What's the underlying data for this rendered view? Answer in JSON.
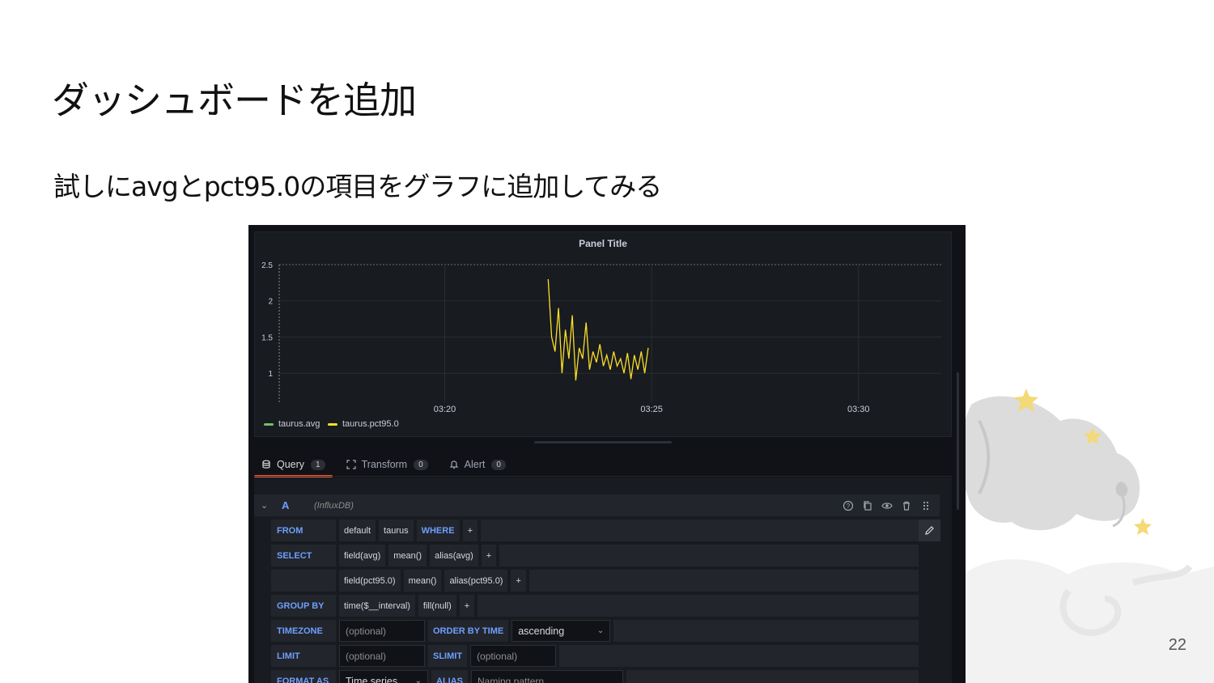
{
  "slide": {
    "title": "ダッシュボードを追加",
    "subtitle": "試しにavgとpct95.0の項目をグラフに追加してみる",
    "page_number": "22"
  },
  "panel": {
    "title": "Panel Title",
    "legend": [
      {
        "name": "taurus.avg",
        "color": "#73bf69"
      },
      {
        "name": "taurus.pct95.0",
        "color": "#fade2a"
      }
    ]
  },
  "chart_data": {
    "type": "line",
    "title": "Panel Title",
    "x_ticks": [
      "03:20",
      "03:25",
      "03:30"
    ],
    "y_ticks": [
      1,
      1.5,
      2,
      2.5
    ],
    "ylim": [
      0.6,
      2.5
    ],
    "xlim": [
      "03:16",
      "03:32"
    ],
    "grid": true,
    "legend_placement": "bottom-left",
    "series": [
      {
        "name": "taurus.avg",
        "color": "#73bf69",
        "x": [],
        "y": []
      },
      {
        "name": "taurus.pct95.0",
        "color": "#fade2a",
        "x": [
          "03:22:30",
          "03:22:35",
          "03:22:40",
          "03:22:45",
          "03:22:50",
          "03:22:55",
          "03:23:00",
          "03:23:05",
          "03:23:10",
          "03:23:15",
          "03:23:20",
          "03:23:25",
          "03:23:30",
          "03:23:35",
          "03:23:40",
          "03:23:45",
          "03:23:50",
          "03:23:55",
          "03:24:00",
          "03:24:05",
          "03:24:10",
          "03:24:15",
          "03:24:20",
          "03:24:25",
          "03:24:30",
          "03:24:35",
          "03:24:40",
          "03:24:45",
          "03:24:50",
          "03:24:55"
        ],
        "y": [
          2.3,
          1.5,
          1.3,
          1.9,
          1.0,
          1.6,
          1.2,
          1.8,
          0.9,
          1.35,
          1.2,
          1.7,
          1.05,
          1.3,
          1.15,
          1.4,
          1.1,
          1.25,
          1.05,
          1.3,
          1.1,
          1.2,
          1.0,
          1.28,
          0.92,
          1.25,
          1.05,
          1.3,
          1.0,
          1.35
        ]
      }
    ]
  },
  "tabs": [
    {
      "label": "Query",
      "count": "1"
    },
    {
      "label": "Transform",
      "count": "0"
    },
    {
      "label": "Alert",
      "count": "0"
    }
  ],
  "query": {
    "ref_id": "A",
    "datasource": "(InfluxDB)",
    "from_label": "FROM",
    "from_policy": "default",
    "from_measurement": "taurus",
    "where_label": "WHERE",
    "plus": "+",
    "select_label": "SELECT",
    "select1": {
      "field": "field(avg)",
      "agg": "mean()",
      "alias": "alias(avg)"
    },
    "select2": {
      "field": "field(pct95.0)",
      "agg": "mean()",
      "alias": "alias(pct95.0)"
    },
    "groupby_label": "GROUP BY",
    "groupby_time": "time($__interval)",
    "groupby_fill": "fill(null)",
    "timezone_label": "TIMEZONE",
    "timezone_placeholder": "(optional)",
    "orderby_label": "ORDER BY TIME",
    "orderby_value": "ascending",
    "limit_label": "LIMIT",
    "limit_placeholder": "(optional)",
    "slimit_label": "SLIMIT",
    "slimit_placeholder": "(optional)",
    "formatas_label": "FORMAT AS",
    "formatas_value": "Time series",
    "alias_label": "ALIAS",
    "alias_placeholder": "Naming pattern"
  }
}
